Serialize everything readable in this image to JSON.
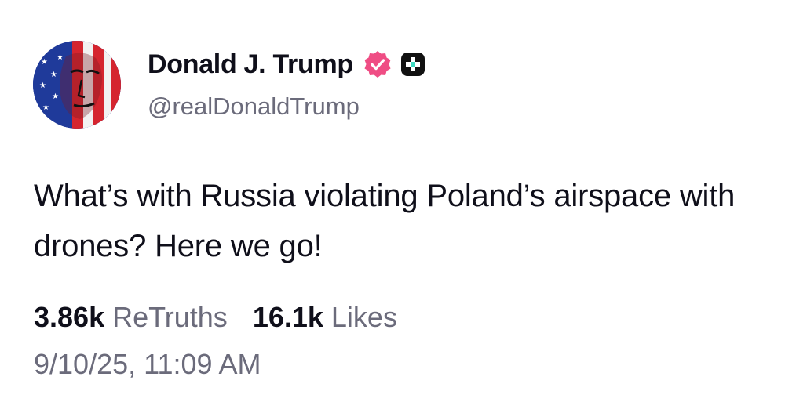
{
  "post": {
    "author": {
      "display_name": "Donald J. Trump",
      "handle": "@realDonaldTrump",
      "verified": true,
      "verified_badge_icon": "verified-badge-icon",
      "subscriber_badge_icon": "plus-icon",
      "avatar_icon": "avatar-flag-portrait"
    },
    "text": "What’s with Russia violating Poland’s airspace with drones? Here we go!",
    "stats": {
      "retruths_count": "3.86k",
      "retruths_label": "ReTruths",
      "likes_count": "16.1k",
      "likes_label": "Likes"
    },
    "timestamp": "9/10/25, 11:09 AM"
  },
  "colors": {
    "text_primary": "#0f0f1a",
    "text_secondary": "#6b6b7b",
    "verified_badge": "#ef4d84",
    "plus_badge": "#111111",
    "plus_accent": "#3dd9c0"
  }
}
